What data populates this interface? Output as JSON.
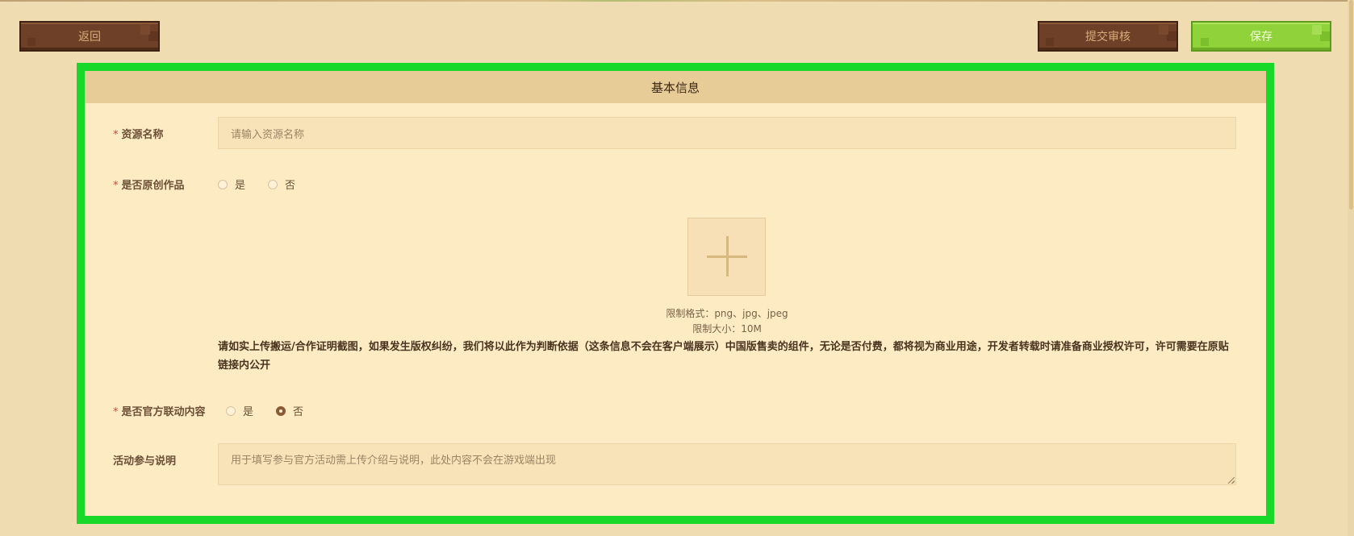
{
  "toolbar": {
    "back_label": "返回",
    "submit_review_label": "提交审核",
    "save_label": "保存"
  },
  "section": {
    "title": "基本信息"
  },
  "fields": {
    "resource_name": {
      "required_mark": "*",
      "label": "资源名称",
      "placeholder": "请输入资源名称",
      "value": ""
    },
    "is_original": {
      "required_mark": "*",
      "label": "是否原创作品",
      "options": [
        "是",
        "否"
      ],
      "selected": null
    },
    "upload": {
      "icon": "plus-icon",
      "hint_format": "限制格式：png、jpg、jpeg",
      "hint_size": "限制大小：10M",
      "notice": "请如实上传搬运/合作证明截图，如果发生版权纠纷，我们将以此作为判断依据（这条信息不会在客户端展示）中国版售卖的组件，无论是否付费，都将视为商业用途，开发者转载时请准备商业授权许可，许可需要在原贴链接内公开"
    },
    "is_official_collab": {
      "required_mark": "*",
      "label": "是否官方联动内容",
      "options": [
        "是",
        "否"
      ],
      "selected": "否"
    },
    "activity_note": {
      "label": "活动参与说明",
      "placeholder": "用于填写参与官方活动需上传介绍与说明，此处内容不会在游戏端出现",
      "value": ""
    }
  },
  "colors": {
    "page_bg": "#efdcb0",
    "panel_bg": "#fdebc4",
    "panel_border_highlight": "#18d92a",
    "header_bg": "#e7cc97",
    "brown_button": "#6e4027",
    "green_button": "#8fd23a",
    "required": "#e0423a"
  }
}
